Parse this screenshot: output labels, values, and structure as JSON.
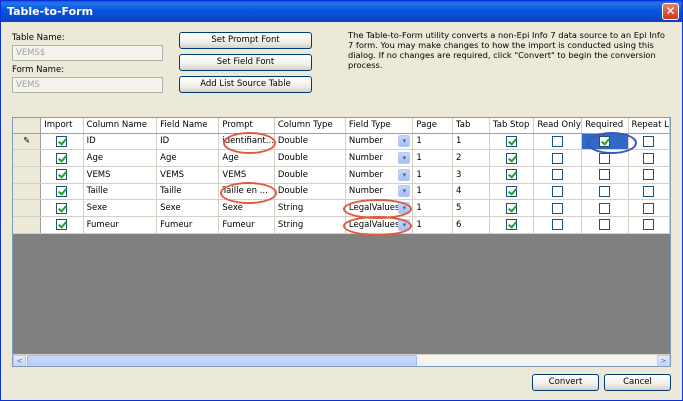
{
  "window": {
    "title": "Table-to-Form",
    "close_glyph": "✕"
  },
  "left_panel": {
    "table_name_label": "Table Name:",
    "table_name_value": "VEMS$",
    "form_name_label": "Form Name:",
    "form_name_value": "VEMS"
  },
  "buttons": {
    "set_prompt_font": "Set Prompt Font",
    "set_field_font": "Set Field Font",
    "add_list_source_table": "Add List Source Table",
    "convert": "Convert",
    "cancel": "Cancel"
  },
  "info_text": "The Table-to-Form utility converts a non-Epi Info 7 data source to an Epi Info 7 form. You may make changes to how the import is conducted using this dialog. If no changes are required, click \"Convert\" to begin the conversion process.",
  "grid": {
    "columns": [
      "Import",
      "Column Name",
      "Field Name",
      "Prompt",
      "Column Type",
      "Field Type",
      "Page",
      "Tab",
      "Tab Stop",
      "Read Only",
      "Required",
      "Repeat L"
    ],
    "rows": [
      {
        "marker": "✎",
        "import": true,
        "column_name": "ID",
        "field_name": "ID",
        "prompt": "identifiant...",
        "column_type": "Double",
        "field_type": "Number",
        "page": "1",
        "tab": "1",
        "tab_stop": true,
        "read_only": false,
        "required": true,
        "repeat": false
      },
      {
        "marker": "",
        "import": true,
        "column_name": "Age",
        "field_name": "Age",
        "prompt": "Age",
        "column_type": "Double",
        "field_type": "Number",
        "page": "1",
        "tab": "2",
        "tab_stop": true,
        "read_only": false,
        "required": false,
        "repeat": false
      },
      {
        "marker": "",
        "import": true,
        "column_name": "VEMS",
        "field_name": "VEMS",
        "prompt": "VEMS",
        "column_type": "Double",
        "field_type": "Number",
        "page": "1",
        "tab": "3",
        "tab_stop": true,
        "read_only": false,
        "required": false,
        "repeat": false
      },
      {
        "marker": "",
        "import": true,
        "column_name": "Taille",
        "field_name": "Taille",
        "prompt": "Taille en ...",
        "column_type": "Double",
        "field_type": "Number",
        "page": "1",
        "tab": "4",
        "tab_stop": true,
        "read_only": false,
        "required": false,
        "repeat": false
      },
      {
        "marker": "",
        "import": true,
        "column_name": "Sexe",
        "field_name": "Sexe",
        "prompt": "Sexe",
        "column_type": "String",
        "field_type": "LegalValues",
        "page": "1",
        "tab": "5",
        "tab_stop": true,
        "read_only": false,
        "required": false,
        "repeat": false
      },
      {
        "marker": "",
        "import": true,
        "column_name": "Fumeur",
        "field_name": "Fumeur",
        "prompt": "Fumeur",
        "column_type": "String",
        "field_type": "LegalValues",
        "page": "1",
        "tab": "6",
        "tab_stop": true,
        "read_only": false,
        "required": false,
        "repeat": false
      }
    ],
    "scroll_left_glyph": "<",
    "scroll_right_glyph": ">",
    "combo_arrow_glyph": "▾"
  },
  "colors": {
    "title_bar": "#0a5fdc",
    "highlight_ring": "#e05a3c",
    "selected_cell": "#316ac5"
  }
}
